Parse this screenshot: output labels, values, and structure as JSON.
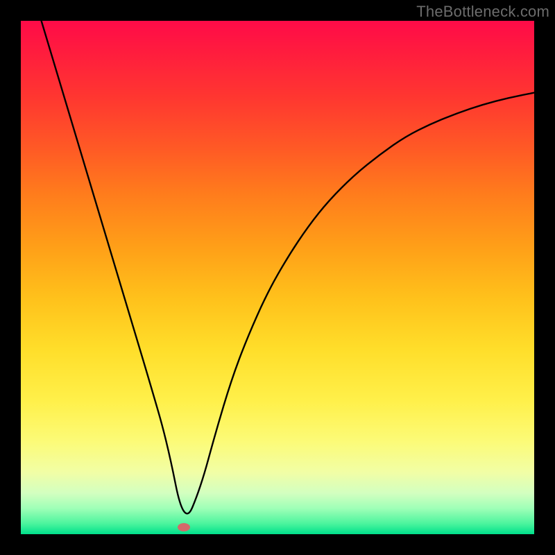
{
  "watermark": "TheBottleneck.com",
  "marker": {
    "x_frac": 0.318,
    "y_frac": 0.986
  },
  "chart_data": {
    "type": "line",
    "title": "",
    "xlabel": "",
    "ylabel": "",
    "xlim": [
      0,
      100
    ],
    "ylim": [
      0,
      100
    ],
    "series": [
      {
        "name": "bottleneck-curve",
        "x": [
          4,
          7,
          10,
          13,
          16,
          19,
          22,
          25,
          28.5,
          31.8,
          35,
          38,
          41,
          44,
          48,
          52,
          56,
          60,
          65,
          70,
          75,
          80,
          85,
          90,
          95,
          100
        ],
        "y": [
          100,
          90,
          80,
          70,
          60,
          50,
          40,
          30,
          18,
          1.4,
          9,
          20,
          30,
          38,
          47,
          54,
          60,
          65,
          70,
          74,
          77.5,
          80,
          82,
          83.7,
          85,
          86
        ]
      }
    ],
    "annotations": [
      {
        "type": "marker",
        "x": 31.8,
        "y": 1.4,
        "color": "#d36a6a"
      }
    ]
  }
}
